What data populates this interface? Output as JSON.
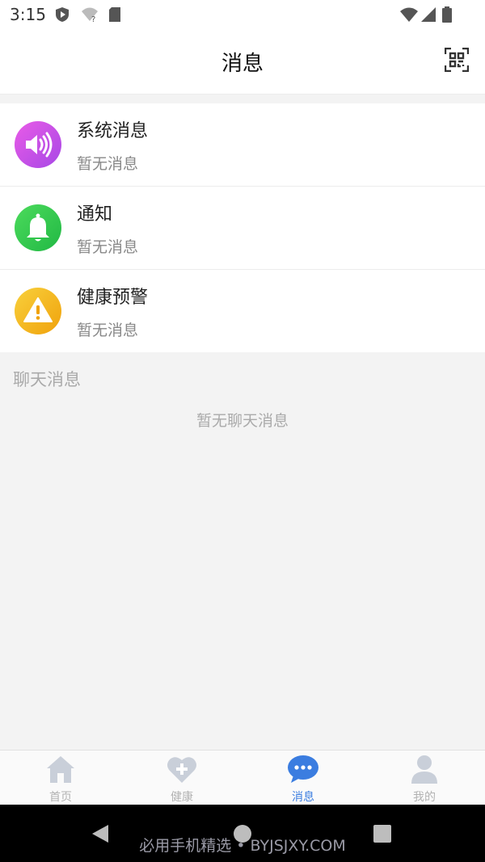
{
  "status_bar": {
    "time": "3:15",
    "icons": [
      "shield-play-icon",
      "wifi-question-icon",
      "sim-card-icon",
      "wifi-signal-icon",
      "cell-signal-icon",
      "battery-icon"
    ]
  },
  "header": {
    "title": "消息",
    "scan_icon": "qr-scan-icon"
  },
  "messages": [
    {
      "title": "系统消息",
      "subtitle": "暂无消息",
      "icon": "speaker-icon",
      "color": "#c94fe0"
    },
    {
      "title": "通知",
      "subtitle": "暂无消息",
      "icon": "bell-icon",
      "color": "#2ec84a"
    },
    {
      "title": "健康预警",
      "subtitle": "暂无消息",
      "icon": "warning-icon",
      "color": "#f2b51c"
    }
  ],
  "chat": {
    "section_title": "聊天消息",
    "empty_text": "暂无聊天消息"
  },
  "tabs": [
    {
      "label": "首页",
      "icon": "home-icon",
      "active": false
    },
    {
      "label": "健康",
      "icon": "heart-plus-icon",
      "active": false
    },
    {
      "label": "消息",
      "icon": "chat-bubble-icon",
      "active": true
    },
    {
      "label": "我的",
      "icon": "person-icon",
      "active": false
    }
  ],
  "colors": {
    "accent": "#3b7de0",
    "tab_inactive": "#c9cfd9",
    "background": "#f3f3f3"
  },
  "watermark": "必用手机精选 • BYJSJXY.COM"
}
